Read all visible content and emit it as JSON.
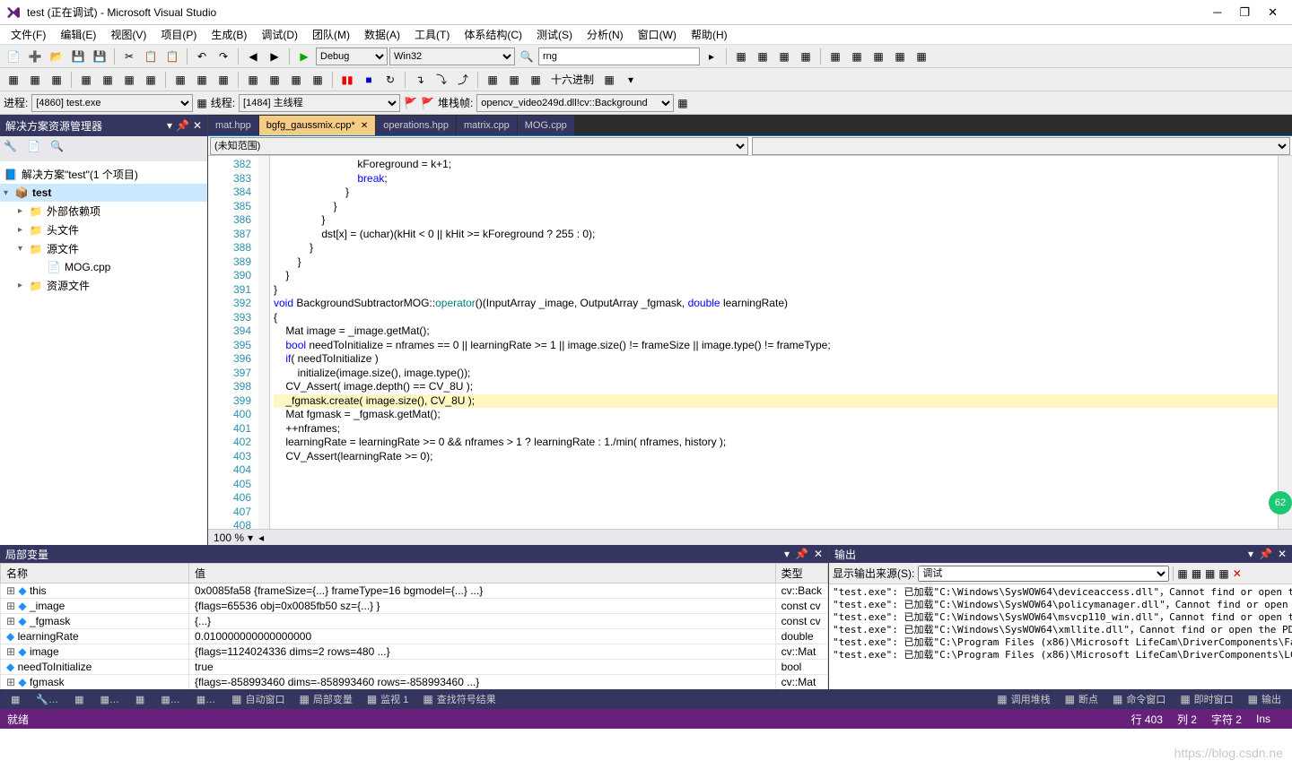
{
  "titlebar": {
    "title": "test (正在调试) - Microsoft Visual Studio"
  },
  "menu": [
    "文件(F)",
    "编辑(E)",
    "视图(V)",
    "项目(P)",
    "生成(B)",
    "调试(D)",
    "团队(M)",
    "数据(A)",
    "工具(T)",
    "体系结构(C)",
    "测试(S)",
    "分析(N)",
    "窗口(W)",
    "帮助(H)"
  ],
  "toolbar1": {
    "config": "Debug",
    "platform": "Win32",
    "search": "rng"
  },
  "toolbar2": {
    "hex": "十六进制",
    "process_label": "进程:",
    "process": "[4860] test.exe",
    "thread_label": "线程:",
    "thread": "[1484] 主线程",
    "stack_label": "堆栈帧:",
    "stack": "opencv_video249d.dll!cv::Background"
  },
  "explorer": {
    "title": "解决方案资源管理器",
    "solution": "解决方案\"test\"(1 个项目)",
    "project": "test",
    "folders": [
      {
        "name": "外部依赖项",
        "icon": "folder"
      },
      {
        "name": "头文件",
        "icon": "folder"
      },
      {
        "name": "源文件",
        "icon": "folder",
        "expanded": true,
        "children": [
          {
            "name": "MOG.cpp",
            "icon": "cpp"
          }
        ]
      },
      {
        "name": "资源文件",
        "icon": "folder"
      }
    ]
  },
  "tabs": [
    {
      "label": "mat.hpp",
      "active": false
    },
    {
      "label": "bgfg_gaussmix.cpp*",
      "active": true,
      "close": true
    },
    {
      "label": "operations.hpp",
      "active": false
    },
    {
      "label": "matrix.cpp",
      "active": false
    },
    {
      "label": "MOG.cpp",
      "active": false
    }
  ],
  "breadcrumb": {
    "scope": "(未知范围)"
  },
  "code": {
    "start": 382,
    "lines": [
      "                            kForeground = k+1;",
      "                            break;",
      "                        }",
      "                    }",
      "                }",
      "",
      "                dst[x] = (uchar)(kHit < 0 || kHit >= kForeground ? 255 : 0);",
      "            }",
      "        }",
      "    }",
      "}",
      "",
      "void BackgroundSubtractorMOG::operator()(InputArray _image, OutputArray _fgmask, double learningRate)",
      "{",
      "    Mat image = _image.getMat();",
      "    bool needToInitialize = nframes == 0 || learningRate >= 1 || image.size() != frameSize || image.type() != frameType;",
      "",
      "    if( needToInitialize )",
      "        initialize(image.size(), image.type());",
      "",
      "    CV_Assert( image.depth() == CV_8U );",
      "    _fgmask.create( image.size(), CV_8U );",
      "    Mat fgmask = _fgmask.getMat();",
      "",
      "    ++nframes;",
      "    learningRate = learningRate >= 0 && nframes > 1 ? learningRate : 1./min( nframes, history );",
      "    CV_Assert(learningRate >= 0);"
    ],
    "current_line": 403
  },
  "zoom": "100 %",
  "locals": {
    "title": "局部变量",
    "headers": [
      "名称",
      "值",
      "类型"
    ],
    "rows": [
      {
        "name": "this",
        "value": "0x0085fa58 {frameSize={...} frameType=16 bgmodel={...} ...}",
        "type": "cv::Back",
        "exp": true
      },
      {
        "name": "_image",
        "value": "{flags=65536 obj=0x0085fb50 sz={...} }",
        "type": "const cv",
        "exp": true
      },
      {
        "name": "_fgmask",
        "value": "{...}",
        "type": "const cv",
        "exp": true
      },
      {
        "name": "learningRate",
        "value": "0.010000000000000000",
        "type": "double"
      },
      {
        "name": "image",
        "value": "{flags=1124024336 dims=2 rows=480 ...}",
        "type": "cv::Mat",
        "exp": true
      },
      {
        "name": "needToInitialize",
        "value": "true",
        "type": "bool"
      },
      {
        "name": "fgmask",
        "value": "{flags=-858993460 dims=-858993460 rows=-858993460 ...}",
        "type": "cv::Mat",
        "exp": true
      }
    ]
  },
  "output": {
    "title": "输出",
    "source_label": "显示输出来源(S):",
    "source": "调试",
    "lines": [
      "\"test.exe\": 已加载\"C:\\Windows\\SysWOW64\\deviceaccess.dll\"，Cannot find or open th",
      "\"test.exe\": 已加载\"C:\\Windows\\SysWOW64\\policymanager.dll\"，Cannot find or open t",
      "\"test.exe\": 已加载\"C:\\Windows\\SysWOW64\\msvcp110_win.dll\"，Cannot find or open th",
      "\"test.exe\": 已加载\"C:\\Windows\\SysWOW64\\xmllite.dll\"，Cannot find or open the PDB",
      "\"test.exe\": 已加载\"C:\\Program Files (x86)\\Microsoft LifeCam\\DriverComponents\\Fac",
      "\"test.exe\": 已加载\"C:\\Program Files (x86)\\Microsoft LifeCam\\DriverComponents\\LCF"
    ]
  },
  "bottom_tabs_left": [
    "自动窗口",
    "局部变量",
    "监视 1",
    "查找符号结果"
  ],
  "bottom_tabs_right": [
    "调用堆栈",
    "断点",
    "命令窗口",
    "即时窗口",
    "输出"
  ],
  "status": {
    "ready": "就绪",
    "line": "行 403",
    "col": "列 2",
    "char": "字符 2",
    "ins": "Ins"
  },
  "watermark": "https://blog.csdn.ne",
  "badge": "62"
}
